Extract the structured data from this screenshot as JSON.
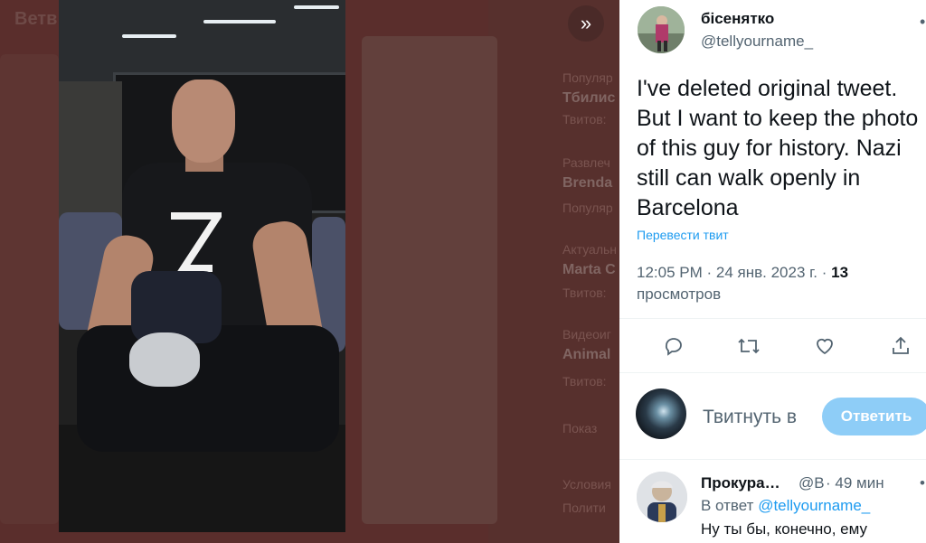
{
  "background": {
    "title": "Ветв",
    "lines": [
      {
        "text": "Популяр",
        "bold": false
      },
      {
        "text": "Тбилис",
        "bold": true
      },
      {
        "text": "Твитов:",
        "bold": false
      },
      {
        "text": "Развлеч",
        "bold": false
      },
      {
        "text": "Brenda",
        "bold": true
      },
      {
        "text": "Популяр",
        "bold": false
      },
      {
        "text": "Актуальн",
        "bold": false
      },
      {
        "text": "Marta C",
        "bold": true
      },
      {
        "text": "Твитов:",
        "bold": false
      },
      {
        "text": "Видеоиг",
        "bold": false
      },
      {
        "text": "Animal",
        "bold": true
      },
      {
        "text": "Твитов:",
        "bold": false
      },
      {
        "text": "Показ",
        "bold": false
      },
      {
        "text": "Условия",
        "bold": false
      },
      {
        "text": "Полити",
        "bold": false
      }
    ]
  },
  "viewer": {
    "expand_icon": "double-chevron-right-icon",
    "expand_glyph": "»"
  },
  "tweet": {
    "display_name": "бісенятко",
    "handle": "@tellyourname_",
    "text": "I've deleted original tweet. But I want to keep the photo of this guy for history. Nazi still can walk openly in Barcelona",
    "translate_label": "Перевести твит",
    "time": "12:05 PM",
    "date": "24 янв. 2023 г.",
    "views_count": "13",
    "views_label": "просмотров",
    "actions": [
      {
        "name": "reply-icon"
      },
      {
        "name": "retweet-icon"
      },
      {
        "name": "like-icon"
      },
      {
        "name": "share-icon"
      }
    ]
  },
  "composer": {
    "placeholder": "Твитнуть в",
    "reply_button": "Ответить"
  },
  "reply": {
    "name": "Прокура…",
    "handle": "@B",
    "time": "· 49 мин",
    "context_prefix": "В ответ",
    "context_handle": "@tellyourname_",
    "text": "Ну ты бы, конечно, ему"
  },
  "colors": {
    "accent": "#1d9bf0",
    "reply_button_disabled": "#8ecdf7",
    "overlay": "#5a2e2c"
  }
}
